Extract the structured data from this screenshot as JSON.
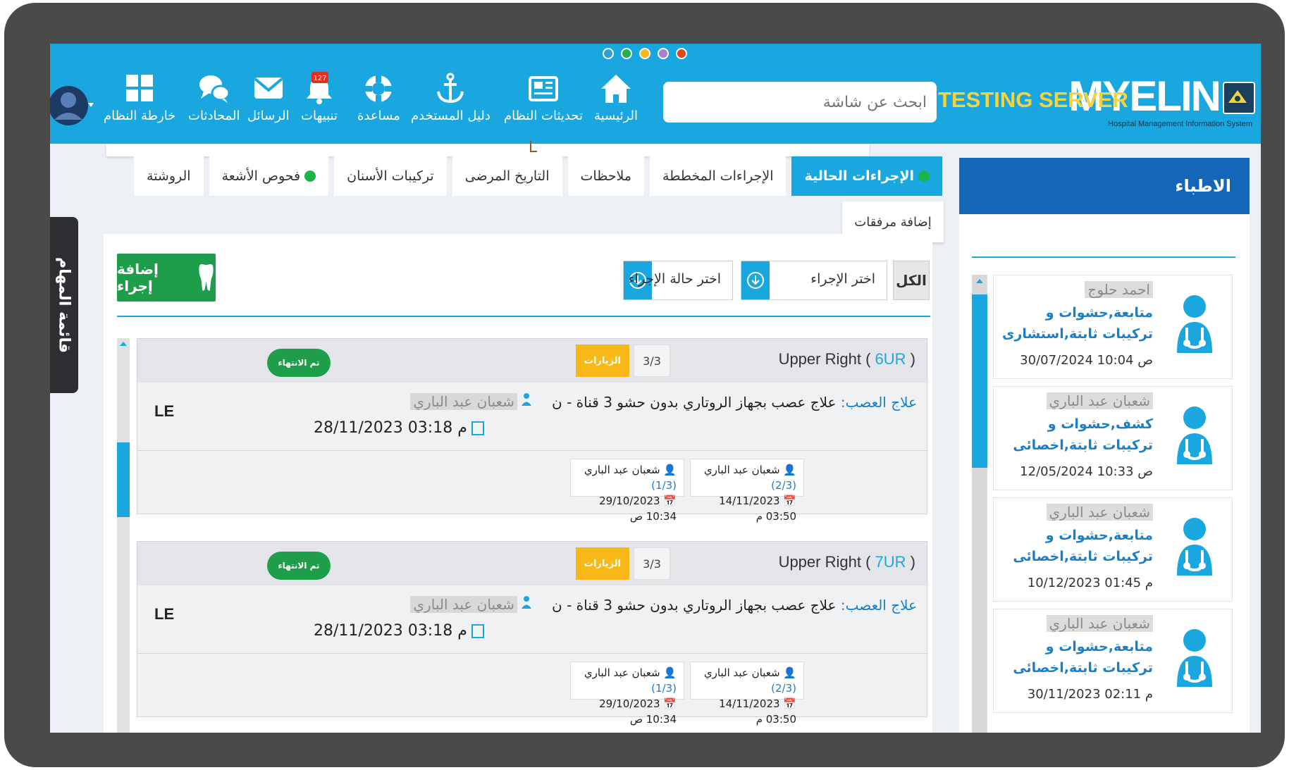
{
  "header": {
    "dot_colors": [
      "#2b9fe0",
      "#1db34a",
      "#f7b818",
      "#a87ed8",
      "#e0471a"
    ],
    "logo": {
      "name": "MYELIN",
      "subtitle": "Hospital Management Information System"
    },
    "server_label": "TESTING SERVER",
    "search_placeholder": "ابحث عن شاشة",
    "nav": [
      {
        "label": "الرئيسية",
        "icon": "home-icon"
      },
      {
        "label": "تحديثات النظام",
        "icon": "newspaper-icon"
      },
      {
        "label": "دليل المستخدم",
        "icon": "anchor-icon"
      },
      {
        "label": "مساعدة",
        "icon": "lifebuoy-icon"
      },
      {
        "label": "تنبيهات",
        "icon": "bell-icon",
        "badge": "127"
      },
      {
        "label": "الرسائل",
        "icon": "envelope-icon"
      },
      {
        "label": "المحادثات",
        "icon": "chat-icon"
      },
      {
        "label": "خارطة النظام",
        "icon": "grid-icon"
      }
    ]
  },
  "side_tab": {
    "label": "قائمة المهام"
  },
  "tabs": [
    {
      "label": "الإجراءات الحالية",
      "active": true,
      "dot": true
    },
    {
      "label": "الإجراءات المخططة"
    },
    {
      "label": "ملاحظات"
    },
    {
      "label": "التاريخ المرضى"
    },
    {
      "label": "تركيبات الأسنان"
    },
    {
      "label": "فحوص الأشعة",
      "dot": true
    },
    {
      "label": "الروشتة"
    }
  ],
  "sub_tab": "إضافة مرفقات",
  "toolbar": {
    "add_label": "إضافة إجراء",
    "all_label": "الكل",
    "procedure_select": "اختر الإجراء",
    "status_select": "اختر حالة الإجراء"
  },
  "cards": [
    {
      "title_prefix": "Upper Right (",
      "code": "6UR",
      "title_suffix": ")",
      "count": "3/3",
      "visits_label": "الزيارات",
      "done_label": "تم الانتهاء",
      "proc_key": "علاج العصب:",
      "proc_value": "علاج عصب بجهاز الروتاري بدون حشو 3 قناة - ن",
      "doctor": "شعبان عبد الباري",
      "date": "28/11/2023 03:18 م",
      "currency": "LE",
      "history": [
        {
          "name": "شعبان عبد الباري",
          "fraction": "(2/3)",
          "date": "14/11/2023 03:50 م"
        },
        {
          "name": "شعبان عبد الباري",
          "fraction": "(1/3)",
          "date": "29/10/2023 10:34 ص"
        }
      ]
    },
    {
      "title_prefix": "Upper Right (",
      "code": "7UR",
      "title_suffix": ")",
      "count": "3/3",
      "visits_label": "الزيارات",
      "done_label": "تم الانتهاء",
      "proc_key": "علاج العصب:",
      "proc_value": "علاج عصب بجهاز الروتاري بدون حشو 3 قناة - ن",
      "doctor": "شعبان عبد الباري",
      "date": "28/11/2023 03:18 م",
      "currency": "LE",
      "history": [
        {
          "name": "شعبان عبد الباري",
          "fraction": "(2/3)",
          "date": "14/11/2023 03:50 م"
        },
        {
          "name": "شعبان عبد الباري",
          "fraction": "(1/3)",
          "date": "29/10/2023 10:34 ص"
        }
      ]
    }
  ],
  "doctors": {
    "title": "الاطباء",
    "items": [
      {
        "name": "احمد حلوج",
        "specialty": "متابعة,حشوات و تركيبات ثابتة,استشارى",
        "time": "30/07/2024 10:04 ص"
      },
      {
        "name": "شعبان عبد الباري",
        "specialty": "كشف,حشوات و تركيبات ثابتة,اخصائى",
        "time": "12/05/2024 10:33 ص"
      },
      {
        "name": "شعبان عبد الباري",
        "specialty": "متابعة,حشوات و تركيبات ثابتة,اخصائى",
        "time": "10/12/2023 01:45 م"
      },
      {
        "name": "شعبان عبد الباري",
        "specialty": "متابعة,حشوات و تركيبات ثابتة,اخصائى",
        "time": "30/11/2023 02:11 م"
      }
    ]
  }
}
